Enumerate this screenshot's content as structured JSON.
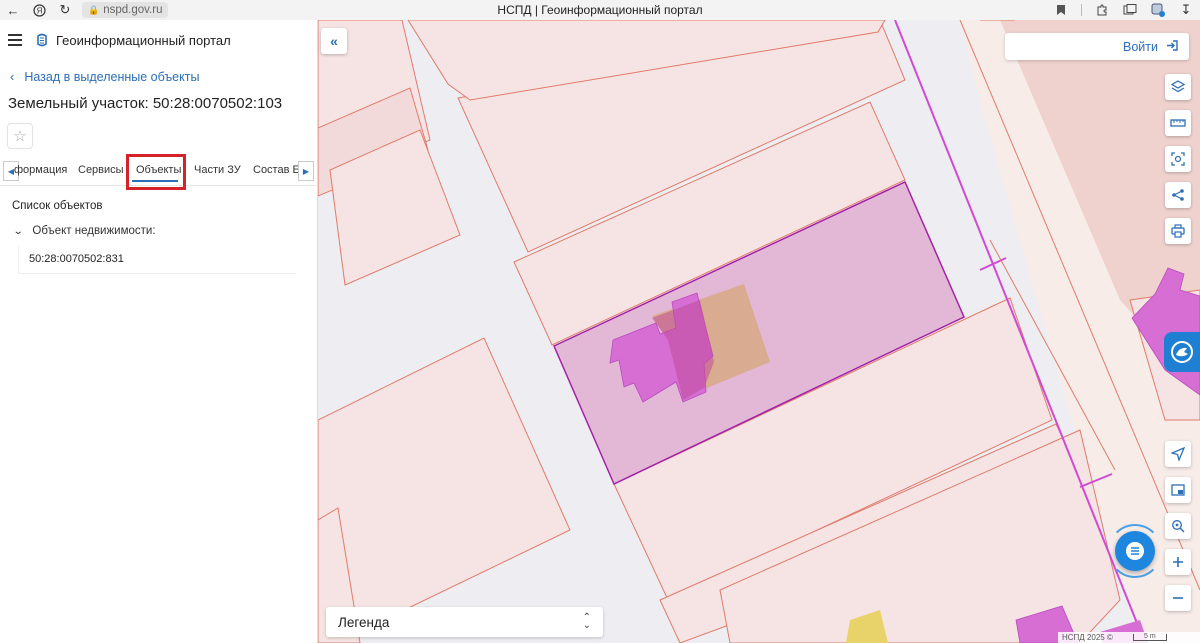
{
  "browser": {
    "url": "nspd.gov.ru",
    "tab_title": "НСПД | Геоинформационный портал",
    "icons": [
      "back-arrow-icon",
      "yandex-icon",
      "reload-icon",
      "lock-icon",
      "bookmark-icon",
      "extensions-icon",
      "collections-icon",
      "profile-icon",
      "download-icon"
    ]
  },
  "sidebar": {
    "portal_title": "Геоинформационный портал",
    "back_label": "Назад в выделенные объекты",
    "parcel_title": "Земельный участок: 50:28:0070502:103",
    "tabs": [
      {
        "label": "формация"
      },
      {
        "label": "Сервисы"
      },
      {
        "label": "Объекты",
        "active": true
      },
      {
        "label": "Части ЗУ"
      },
      {
        "label": "Состав ЕЗ"
      }
    ],
    "objects_heading": "Список объектов",
    "tree_node_label": "Объект недвижимости:",
    "object_number": "50:28:0070502:831"
  },
  "map": {
    "login_label": "Войти",
    "legend_label": "Легенда",
    "attribution": "НСПД 2025 ©",
    "scale_label": "5 m",
    "tools": [
      "layers-icon",
      "ruler-icon",
      "area-select-icon",
      "share-icon",
      "print-icon",
      "locate-icon",
      "minimap-icon",
      "search-location-icon",
      "zoom-in-icon",
      "zoom-out-icon"
    ],
    "colors": {
      "parcel_fill": "#f6e4e4",
      "parcel_stroke": "#e07b6a",
      "selected_fill": "#e3b8d6",
      "selected_stroke": "#a322a8",
      "building_fill": "#d66ed4",
      "boundary_magenta": "#d04ad4",
      "accent": "#2b6fb6"
    }
  }
}
